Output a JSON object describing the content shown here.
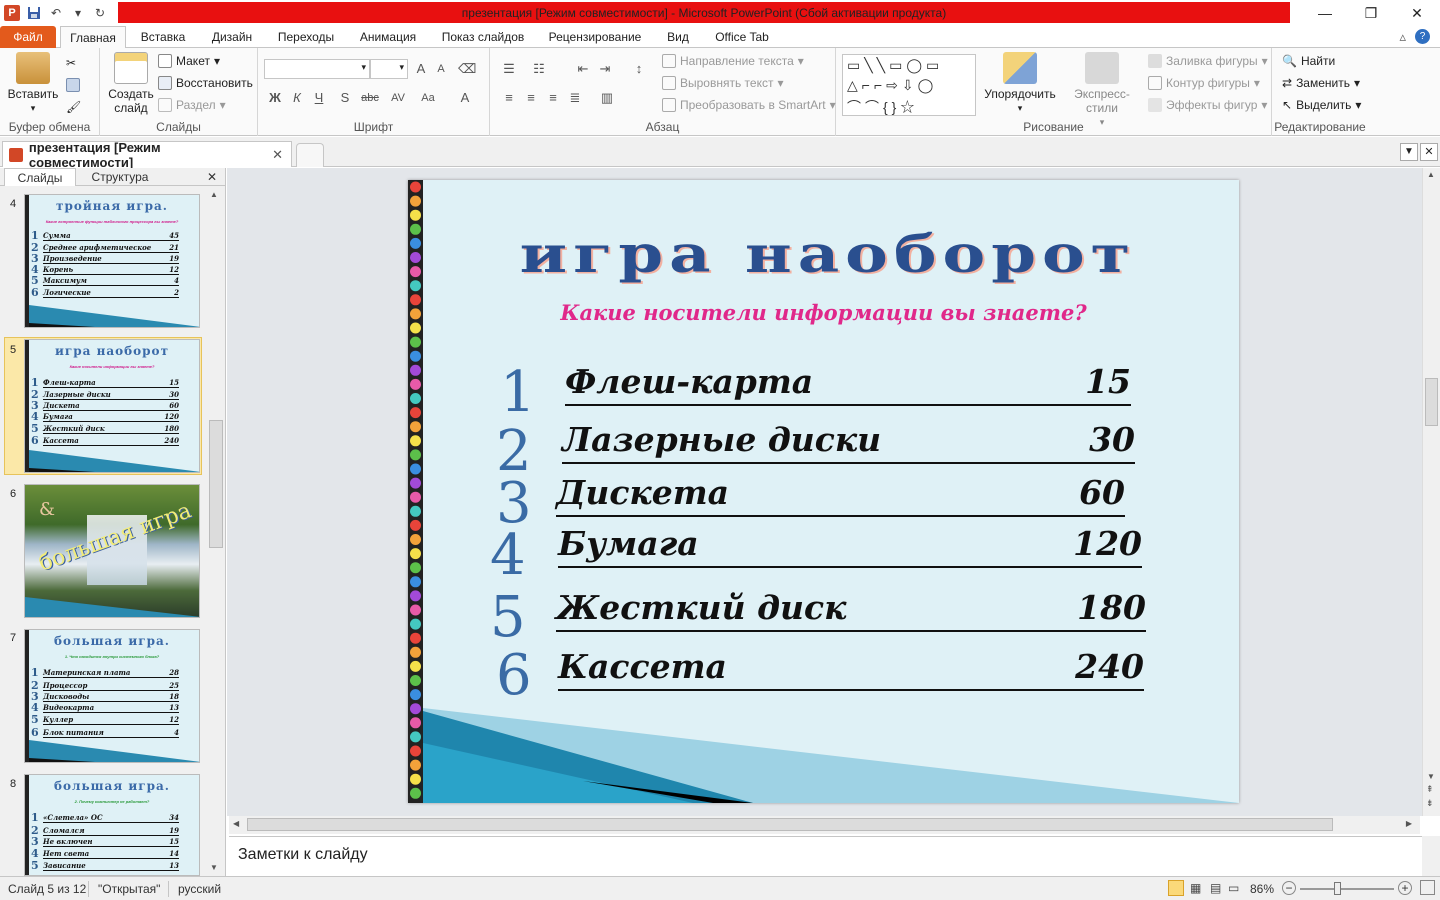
{
  "app": {
    "title": "презентация [Режим совместимости] - Microsoft PowerPoint (Сбой активации продукта)"
  },
  "ribbon_tabs": [
    "Файл",
    "Главная",
    "Вставка",
    "Дизайн",
    "Переходы",
    "Анимация",
    "Показ слайдов",
    "Рецензирование",
    "Вид",
    "Office Tab"
  ],
  "ribbon": {
    "clipboard": {
      "paste": "Вставить",
      "label": "Буфер обмена"
    },
    "slides": {
      "new_slide_1": "Создать",
      "new_slide_2": "слайд",
      "layout": "Макет",
      "reset": "Восстановить",
      "section": "Раздел",
      "label": "Слайды"
    },
    "font": {
      "label": "Шрифт"
    },
    "paragraph": {
      "text_direction": "Направление текста",
      "align_text": "Выровнять текст",
      "smartart": "Преобразовать в SmartArt",
      "label": "Абзац"
    },
    "drawing": {
      "arrange": "Упорядочить",
      "quick_styles": "Экспресс-стили",
      "shape_fill": "Заливка фигуры",
      "shape_outline": "Контур фигуры",
      "shape_effects": "Эффекты фигур",
      "label": "Рисование"
    },
    "editing": {
      "find": "Найти",
      "replace": "Заменить",
      "select": "Выделить",
      "label": "Редактирование"
    }
  },
  "document_tab": {
    "title": "презентация [Режим совместимости]"
  },
  "left_pane": {
    "tabs": {
      "slides": "Слайды",
      "outline": "Структура"
    },
    "thumbs": [
      {
        "num": "4",
        "title": "тройная игра.",
        "question": "Какие встроенные функции табличного процессора вы знаете?",
        "rows": [
          [
            "1",
            "Сумма",
            "45"
          ],
          [
            "2",
            "Среднее арифметическое",
            "21"
          ],
          [
            "3",
            "Произведение",
            "19"
          ],
          [
            "4",
            "Корень",
            "12"
          ],
          [
            "5",
            "Максимум",
            "4"
          ],
          [
            "6",
            "Логические",
            "2"
          ]
        ]
      },
      {
        "num": "5",
        "title": "игра наоборот",
        "question": "Какие носители информации вы знаете?",
        "rows": [
          [
            "1",
            "Флеш-карта",
            "15"
          ],
          [
            "2",
            "Лазерные диски",
            "30"
          ],
          [
            "3",
            "Дискета",
            "60"
          ],
          [
            "4",
            "Бумага",
            "120"
          ],
          [
            "5",
            "Жесткий диск",
            "180"
          ],
          [
            "6",
            "Кассета",
            "240"
          ]
        ]
      },
      {
        "num": "6",
        "title": "большая игра",
        "caption": "&"
      },
      {
        "num": "7",
        "title": "большая игра.",
        "question": "1. Что находится внутри системного блока?",
        "rows": [
          [
            "1",
            "Материнская плата",
            "28"
          ],
          [
            "2",
            "Процессор",
            "25"
          ],
          [
            "3",
            "Дисководы",
            "18"
          ],
          [
            "4",
            "Видеокарта",
            "13"
          ],
          [
            "5",
            "Куллер",
            "12"
          ],
          [
            "6",
            "Блок питания",
            "4"
          ]
        ]
      },
      {
        "num": "8",
        "title": "большая игра.",
        "question": "2. Почему компьютер не работает?",
        "rows": [
          [
            "1",
            "«Слетела» ОС",
            "34"
          ],
          [
            "2",
            "Сломался",
            "19"
          ],
          [
            "3",
            "Не включен",
            "15"
          ],
          [
            "4",
            "Нет света",
            "14"
          ],
          [
            "5",
            "Зависание",
            "13"
          ]
        ]
      }
    ]
  },
  "slide": {
    "title": "игра наоборот",
    "question": "Какие носители информации вы знаете?",
    "rows": [
      {
        "num": "1",
        "label": "Флеш-карта",
        "value": "15"
      },
      {
        "num": "2",
        "label": "Лазерные диски",
        "value": "30"
      },
      {
        "num": "3",
        "label": "Дискета",
        "value": "60"
      },
      {
        "num": "4",
        "label": "Бумага",
        "value": "120"
      },
      {
        "num": "5",
        "label": "Жесткий диск",
        "value": "180"
      },
      {
        "num": "6",
        "label": "Кассета",
        "value": "240"
      }
    ]
  },
  "notes": {
    "placeholder": "Заметки к слайду"
  },
  "status": {
    "slide": "Слайд 5 из 12",
    "theme": "\"Открытая\"",
    "language": "русский",
    "zoom": "86%"
  }
}
